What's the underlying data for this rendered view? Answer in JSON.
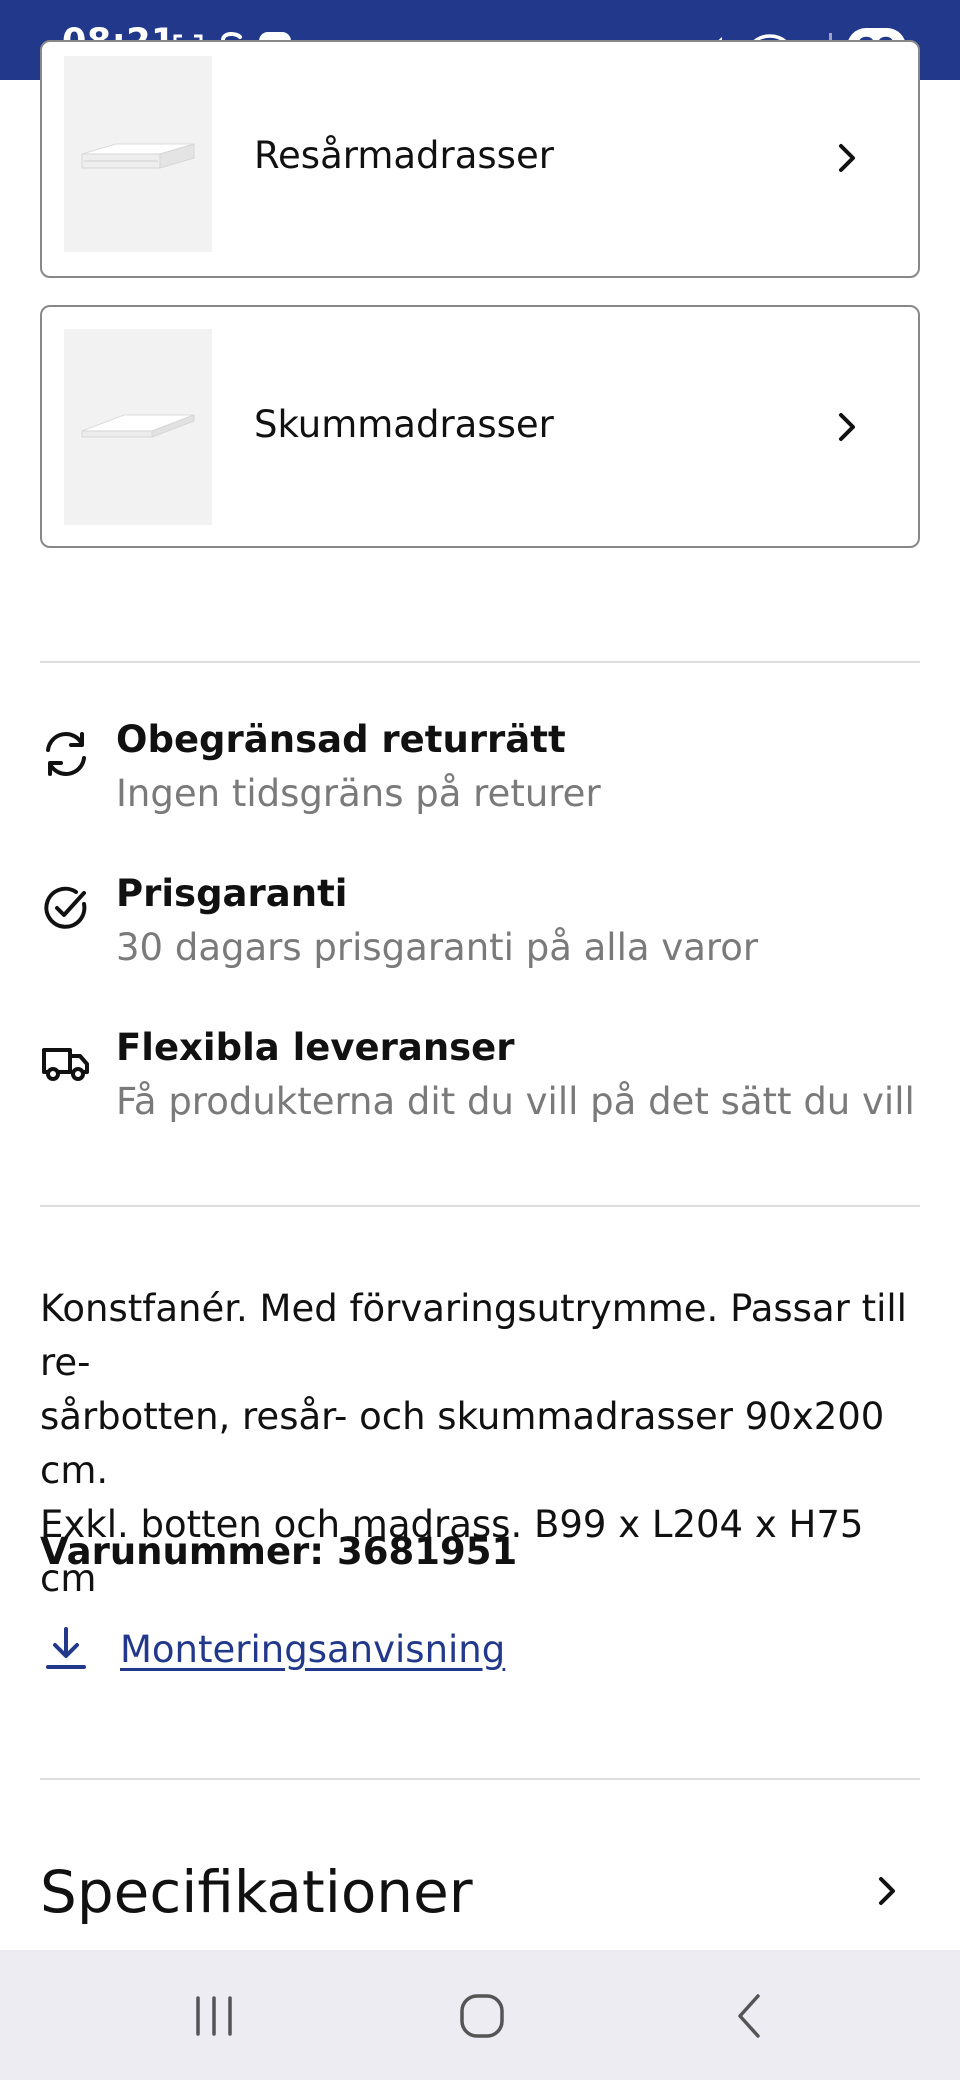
{
  "status_bar": {
    "time": "08:21",
    "left_icons": [
      "screenshot-icon",
      "s-app-icon",
      "play-icon"
    ],
    "right_icons": [
      "mute-icon",
      "wifi-icon",
      "signal-icon"
    ],
    "battery": "99",
    "background": "#22398b"
  },
  "categories": [
    {
      "label": "Resårmadrasser",
      "icon": "spring-mattress-thumbnail"
    },
    {
      "label": "Skummadrasser",
      "icon": "foam-mattress-thumbnail"
    }
  ],
  "benefits": [
    {
      "title": "Obegränsad returrätt",
      "subtitle": "Ingen tidsgräns på returer",
      "icon": "return-arrows-icon"
    },
    {
      "title": "Prisgaranti",
      "subtitle": "30 dagars prisgaranti på alla varor",
      "icon": "check-circle-icon"
    },
    {
      "title": "Flexibla leveranser",
      "subtitle": "Få produkterna dit du vill på det sätt du vill",
      "icon": "truck-icon"
    }
  ],
  "description": {
    "line1": "Konstfanér. Med förvaringsutrymme. Passar till re-",
    "line2": "sårbotten, resår- och skummadrasser 90x200 cm.",
    "line3": "Exkl. botten och madrass. B99 x L204 x H75 cm"
  },
  "article_number": "Varunummer: 3681951",
  "download": {
    "label": "Monteringsanvisning",
    "icon": "download-icon"
  },
  "specs": {
    "title": "Specifikationer"
  },
  "nav_bar": {
    "buttons": [
      "recent-apps",
      "home",
      "back"
    ]
  },
  "colors": {
    "accent": "#22398b",
    "muted_text": "#7a7a7a",
    "border": "#888888",
    "divider": "#dddddd",
    "nav_bg": "#edecf2"
  }
}
